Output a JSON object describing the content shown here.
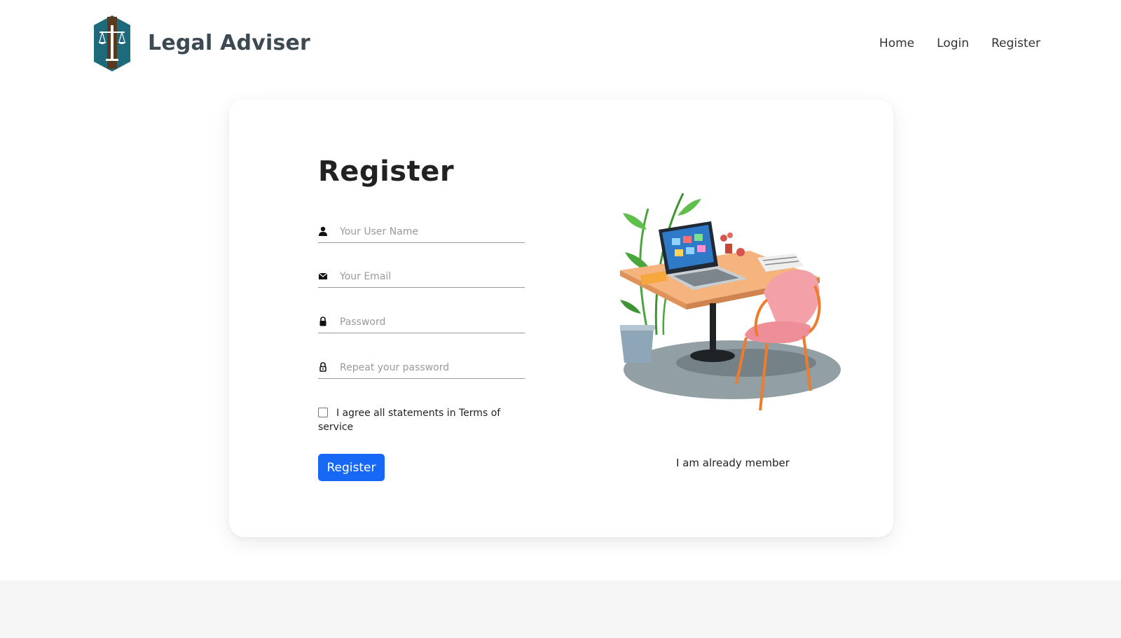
{
  "brand": {
    "name": "Legal Adviser",
    "logo_icon": "scales-of-justice-logo",
    "colors": {
      "teal": "#1d6a7a",
      "brown": "#5a3a1e"
    }
  },
  "nav": {
    "items": [
      {
        "label": "Home"
      },
      {
        "label": "Login"
      },
      {
        "label": "Register"
      }
    ]
  },
  "form": {
    "title": "Register",
    "fields": [
      {
        "icon": "user-icon",
        "placeholder": "Your User Name",
        "value": ""
      },
      {
        "icon": "envelope-icon",
        "placeholder": "Your Email",
        "value": ""
      },
      {
        "icon": "lock-icon",
        "placeholder": "Password",
        "value": ""
      },
      {
        "icon": "lock-outline-icon",
        "placeholder": "Repeat your password",
        "value": ""
      }
    ],
    "agree_text": "I agree all statements in Terms of service",
    "agree_checked": false,
    "submit_label": "Register",
    "accent_color": "#1769f5"
  },
  "aside": {
    "illustration": "desk-with-laptop-plant-and-chair",
    "member_link": "I am already member"
  }
}
